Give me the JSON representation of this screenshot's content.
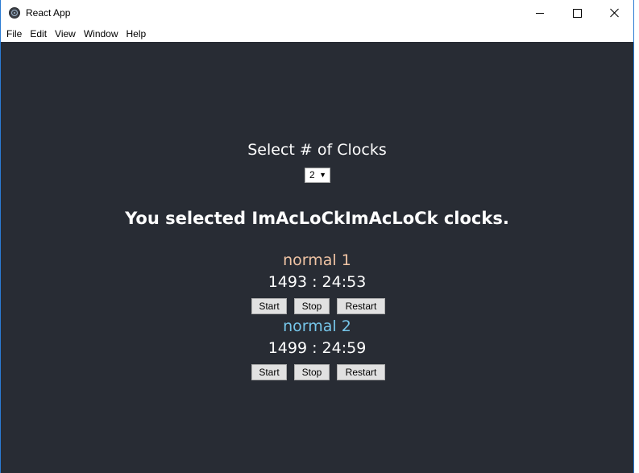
{
  "window": {
    "title": "React App",
    "minimize_icon": "minimize-icon",
    "maximize_icon": "maximize-icon",
    "close_icon": "close-icon",
    "app_icon": "electron-app-icon"
  },
  "menu": {
    "items": [
      {
        "label": "File"
      },
      {
        "label": "Edit"
      },
      {
        "label": "View"
      },
      {
        "label": "Window"
      },
      {
        "label": "Help"
      }
    ]
  },
  "app": {
    "background_color": "#282c34",
    "select_heading": "Select # of Clocks",
    "select_value": "2",
    "select_arrow": "▼",
    "selected_message": "You selected ImAcLoCkImAcLoCk clocks.",
    "clocks": [
      {
        "name": "normal 1",
        "color": "#f0c4a4",
        "time": "1493 : 24:53",
        "buttons": {
          "start": "Start",
          "stop": "Stop",
          "restart": "Restart"
        }
      },
      {
        "name": "normal 2",
        "color": "#76c6ea",
        "time": "1499 : 24:59",
        "buttons": {
          "start": "Start",
          "stop": "Stop",
          "restart": "Restart"
        }
      }
    ]
  }
}
